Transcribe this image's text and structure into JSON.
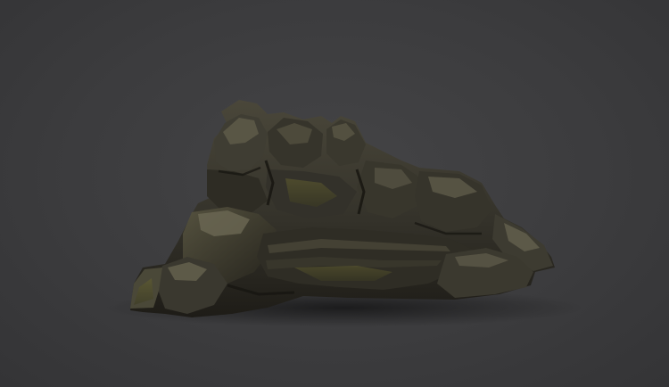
{
  "scene": {
    "subject": "rock-boulder-icon",
    "background_color": "#3a3a3c",
    "rock_colors": {
      "dark": "#1f1d18",
      "mid": "#3b3a30",
      "light": "#5b5848",
      "moss": "#5a5a2e",
      "highlight": "#7a7662"
    }
  }
}
